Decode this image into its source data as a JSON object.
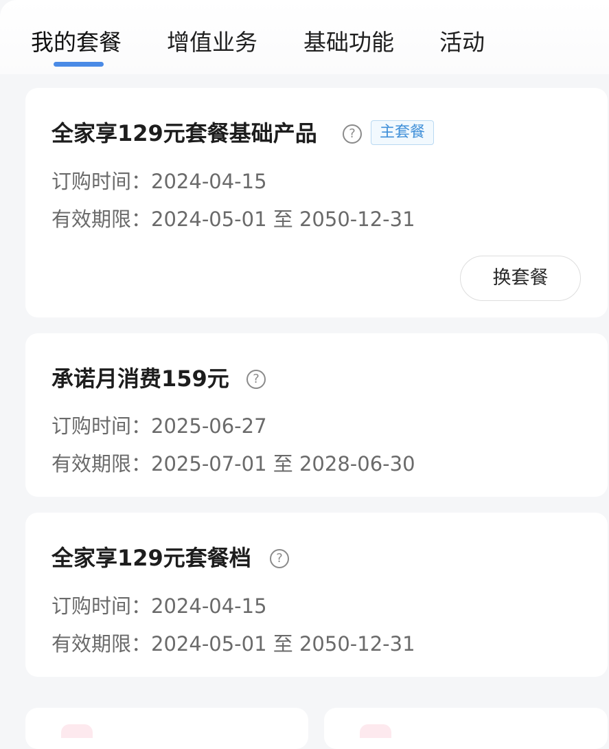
{
  "tabs": [
    {
      "label": "我的套餐",
      "active": true
    },
    {
      "label": "增值业务",
      "active": false
    },
    {
      "label": "基础功能",
      "active": false
    },
    {
      "label": "活动",
      "active": false
    }
  ],
  "plans": [
    {
      "title": "全家享129元套餐基础产品",
      "badge": "主套餐",
      "order_label": "订购时间：",
      "order_date": "2024-04-15",
      "valid_label": "有效期限：",
      "valid_range": "2024-05-01 至  2050-12-31",
      "action": "换套餐"
    },
    {
      "title": "承诺月消费159元",
      "order_label": "订购时间：",
      "order_date": "2025-06-27",
      "valid_label": "有效期限：",
      "valid_range": "2025-07-01 至  2028-06-30"
    },
    {
      "title": "全家享129元套餐档",
      "order_label": "订购时间：",
      "order_date": "2024-04-15",
      "valid_label": "有效期限：",
      "valid_range": "2024-05-01 至  2050-12-31"
    }
  ],
  "help_glyph": "?",
  "colors": {
    "accent": "#4a8be6",
    "badge_text": "#3f8fd8",
    "background": "#f5f6f8"
  }
}
